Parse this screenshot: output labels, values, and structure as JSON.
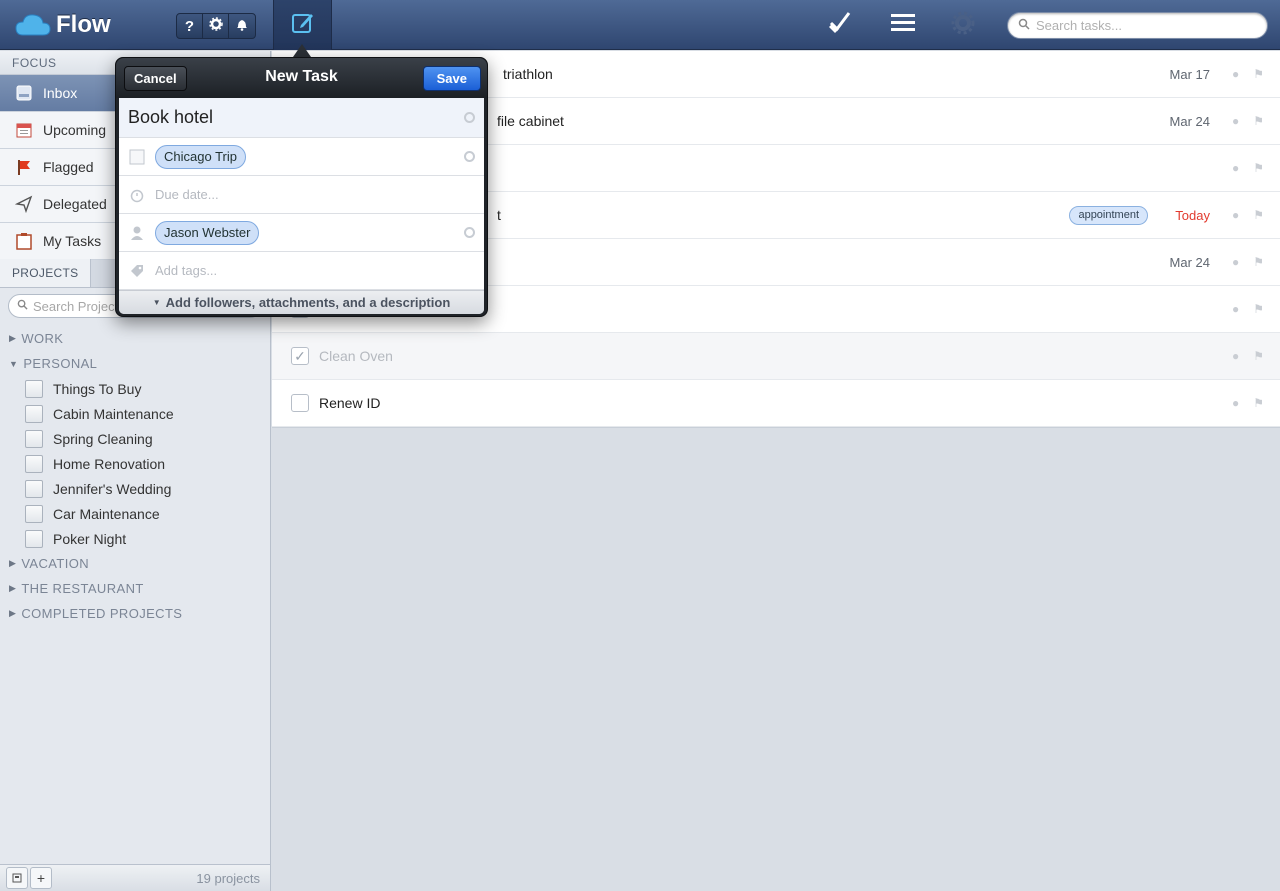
{
  "app": {
    "name": "Flow"
  },
  "header": {
    "help_label": "?",
    "search_placeholder": "Search tasks..."
  },
  "sidebar": {
    "focus_header": "FOCUS",
    "focus_items": [
      {
        "label": "Inbox",
        "icon": "inbox-icon",
        "active": true
      },
      {
        "label": "Upcoming",
        "icon": "calendar-icon"
      },
      {
        "label": "Flagged",
        "icon": "flag-icon"
      },
      {
        "label": "Delegated",
        "icon": "delegated-icon"
      },
      {
        "label": "My Tasks",
        "icon": "my-tasks-icon"
      }
    ],
    "projects_tab": "PROJECTS",
    "projects_search_placeholder": "Search Projects",
    "groups": {
      "work": "WORK",
      "personal": "PERSONAL",
      "vacation": "VACATION",
      "restaurant": "THE RESTAURANT",
      "completed": "COMPLETED PROJECTS"
    },
    "personal_projects": [
      "Things To Buy",
      "Cabin Maintenance",
      "Spring Cleaning",
      "Home Renovation",
      "Jennifer's Wedding",
      "Car Maintenance",
      "Poker Night"
    ],
    "footer": {
      "add_label": "+",
      "project_count": "19 projects"
    }
  },
  "tasks": [
    {
      "title": "triathlon",
      "date": "Mar 17"
    },
    {
      "title": "file cabinet",
      "date": "Mar 24"
    },
    {
      "title": "",
      "date": ""
    },
    {
      "title": "t",
      "tag": "appointment",
      "date": "Today"
    },
    {
      "title": "",
      "date": "Mar 24"
    },
    {
      "title": "",
      "date": ""
    },
    {
      "title": "Clean Oven",
      "date": "",
      "done": true
    },
    {
      "title": "Renew ID",
      "date": ""
    }
  ],
  "new_task": {
    "title": "New Task",
    "cancel_label": "Cancel",
    "save_label": "Save",
    "name_value": "Book hotel",
    "project": "Chicago Trip",
    "due_placeholder": "Due date...",
    "assignee": "Jason Webster",
    "tags_placeholder": "Add tags...",
    "more_label": "Add followers, attachments, and a description"
  },
  "colors": {
    "topbar": "#3d5783",
    "accent_blue": "#1b5fd6",
    "today_red": "#e23b2f"
  }
}
